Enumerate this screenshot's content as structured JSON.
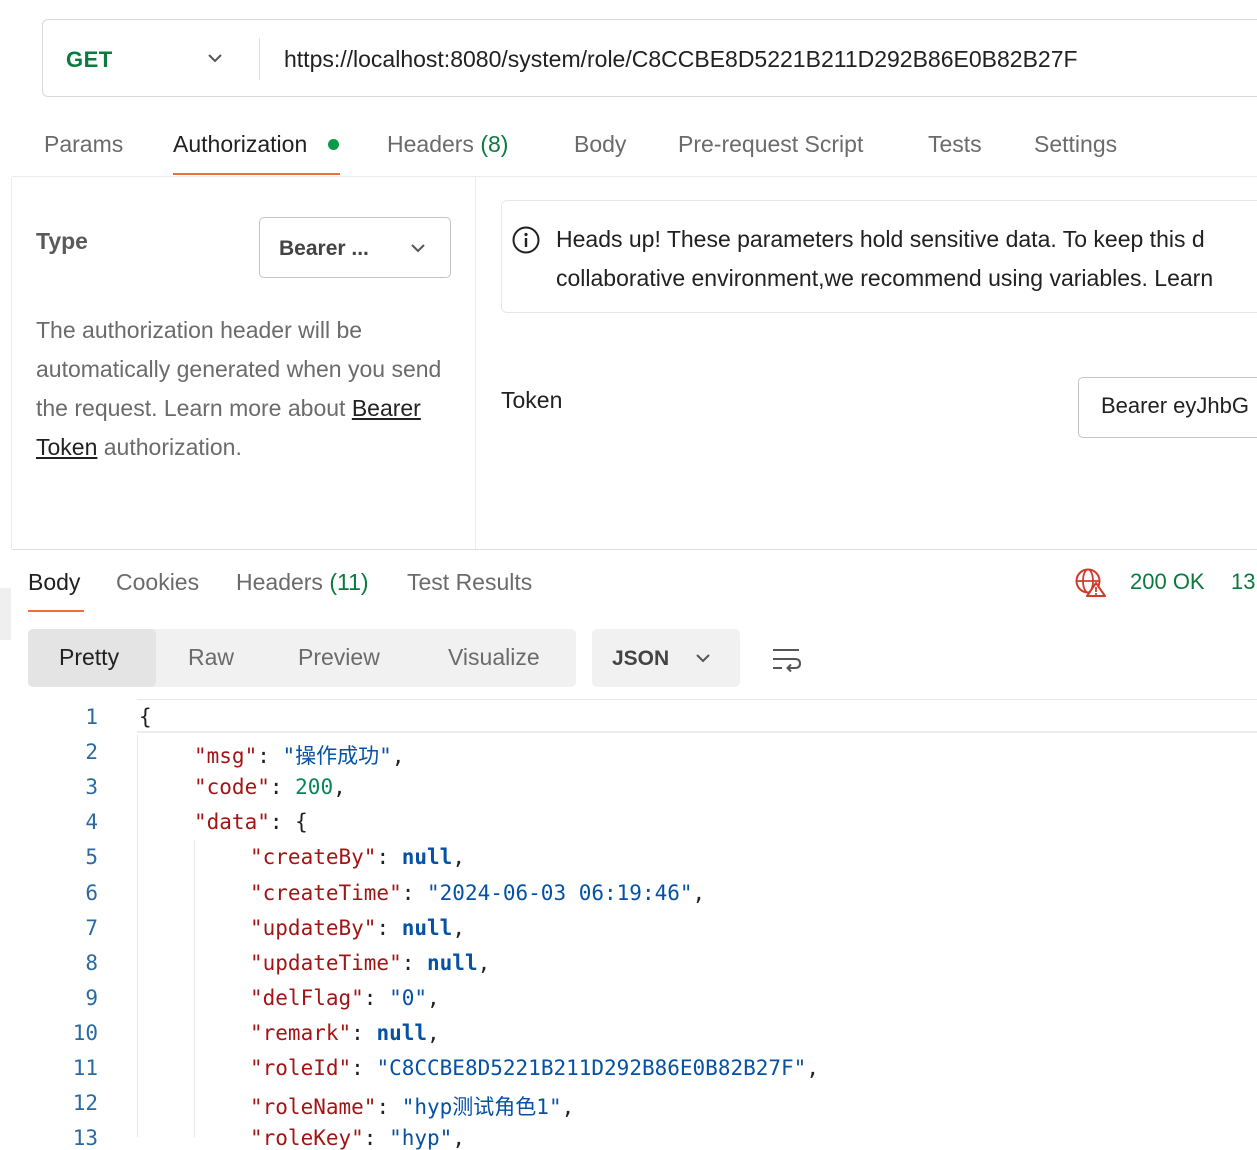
{
  "request": {
    "method": "GET",
    "url": "https://localhost:8080/system/role/C8CCBE8D5221B211D292B86E0B82B27F"
  },
  "request_tabs": {
    "params": "Params",
    "authorization": "Authorization",
    "headers": "Headers",
    "headers_count": "(8)",
    "body": "Body",
    "pre_request": "Pre-request Script",
    "tests": "Tests",
    "settings": "Settings"
  },
  "auth": {
    "type_label": "Type",
    "type_value": "Bearer ...",
    "desc_text": "The authorization header will be automatically generated when you send the request. Learn more about ",
    "desc_link": "Bearer Token",
    "desc_tail": " authorization.",
    "heads_up_line1": "Heads up! These parameters hold sensitive data. To keep this d",
    "heads_up_line2": "collaborative environment,we recommend using variables. Learn",
    "token_label": "Token",
    "token_value": "Bearer eyJhbG"
  },
  "response_tabs": {
    "body": "Body",
    "cookies": "Cookies",
    "headers": "Headers",
    "headers_count": "(11)",
    "test_results": "Test Results"
  },
  "response_status": {
    "status": "200 OK",
    "time": "13"
  },
  "view_modes": {
    "pretty": "Pretty",
    "raw": "Raw",
    "preview": "Preview",
    "visualize": "Visualize",
    "format": "JSON"
  },
  "icons": {
    "method_chevron": "chevron-down-icon",
    "info": "info-circle-icon",
    "globe_warning": "globe-warning-icon",
    "wrap": "text-wrap-icon"
  },
  "colors": {
    "accent": "#f26b3a",
    "method_green": "#0b7a3e",
    "status_green": "#0b7a3e",
    "json_key": "#a31515",
    "json_string": "#0451a5",
    "json_number": "#098658"
  },
  "code": {
    "line_numbers": [
      "1",
      "2",
      "3",
      "4",
      "5",
      "6",
      "7",
      "8",
      "9",
      "10",
      "11",
      "12",
      "13"
    ],
    "l1_brace": "{",
    "msg_key": "\"msg\"",
    "msg_val": "\"操作成功\"",
    "code_key": "\"code\"",
    "code_val": "200",
    "data_key": "\"data\"",
    "createBy_key": "\"createBy\"",
    "createTime_key": "\"createTime\"",
    "createTime_val": "\"2024-06-03 06:19:46\"",
    "updateBy_key": "\"updateBy\"",
    "updateTime_key": "\"updateTime\"",
    "delFlag_key": "\"delFlag\"",
    "delFlag_val": "\"0\"",
    "remark_key": "\"remark\"",
    "roleId_key": "\"roleId\"",
    "roleId_val": "\"C8CCBE8D5221B211D292B86E0B82B27F\"",
    "roleName_key": "\"roleName\"",
    "roleName_val": "\"hyp测试角色1\"",
    "roleKey_key": "\"roleKey\"",
    "roleKey_val": "\"hyp\"",
    "null_literal": "null"
  }
}
